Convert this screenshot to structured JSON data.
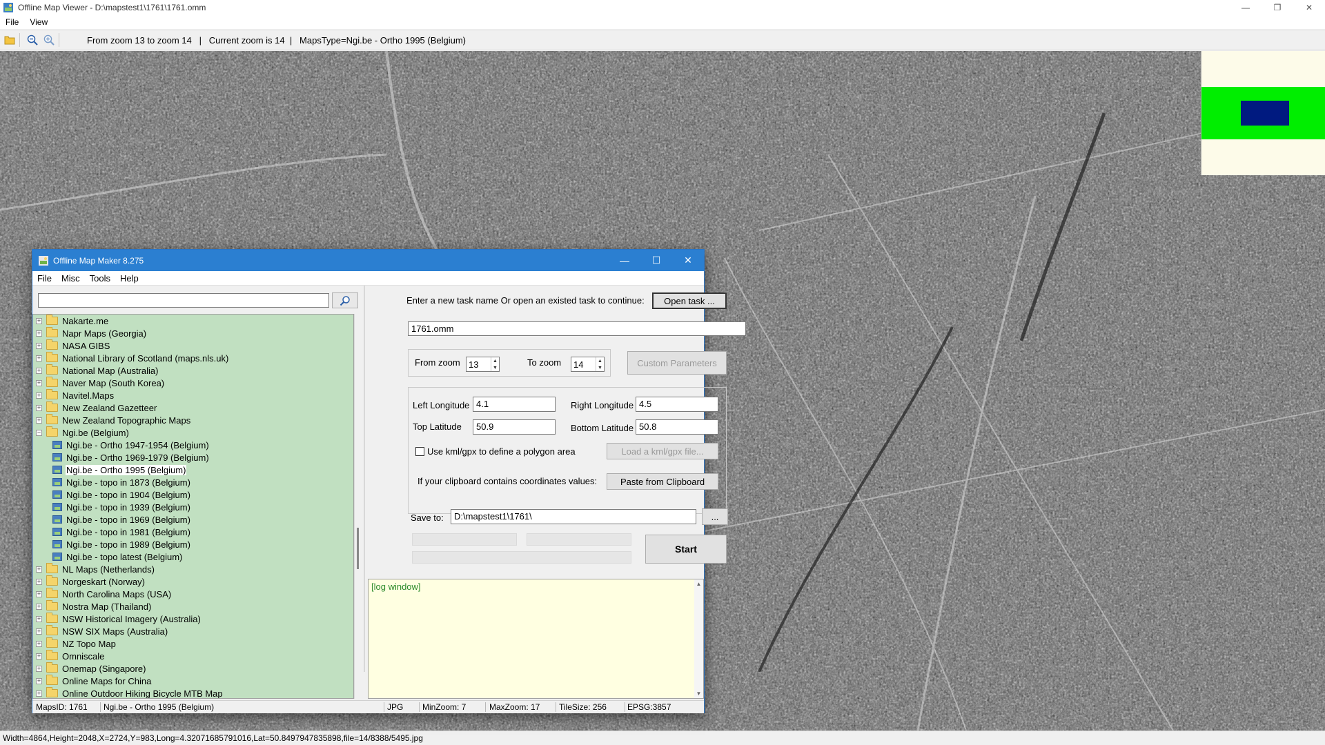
{
  "outer": {
    "title": "Offline Map Viewer - D:\\mapstest1\\1761\\1761.omm",
    "menu": [
      "File",
      "View"
    ],
    "zoom_status": "From zoom 13 to zoom 14   |   Current zoom is 14  |   MapsType=Ngi.be - Ortho 1995 (Belgium)",
    "bottom_status": "Width=4864,Height=2048,X=2724,Y=983,Long=4.32071685791016,Lat=50.8497947835898,file=14/8388/5495.jpg"
  },
  "dialog": {
    "title": "Offline Map Maker 8.275",
    "menu": [
      "File",
      "Misc",
      "Tools",
      "Help"
    ],
    "search": {
      "value": "",
      "placeholder": ""
    },
    "tree": [
      {
        "label": "Nakarte.me",
        "type": "folder",
        "expander": "+"
      },
      {
        "label": "Napr Maps (Georgia)",
        "type": "folder",
        "expander": "+"
      },
      {
        "label": "NASA GIBS",
        "type": "folder",
        "expander": "+"
      },
      {
        "label": "National Library of Scotland (maps.nls.uk)",
        "type": "folder",
        "expander": "+"
      },
      {
        "label": "National Map (Australia)",
        "type": "folder",
        "expander": "+"
      },
      {
        "label": "Naver Map (South Korea)",
        "type": "folder",
        "expander": "+"
      },
      {
        "label": "Navitel.Maps",
        "type": "folder",
        "expander": "+"
      },
      {
        "label": "New Zealand Gazetteer",
        "type": "folder",
        "expander": "+"
      },
      {
        "label": "New Zealand Topographic Maps",
        "type": "folder",
        "expander": "+"
      },
      {
        "label": "Ngi.be (Belgium)",
        "type": "folder",
        "expander": "−"
      },
      {
        "label": "Ngi.be - Ortho 1947-1954 (Belgium)",
        "type": "map"
      },
      {
        "label": "Ngi.be - Ortho 1969-1979 (Belgium)",
        "type": "map"
      },
      {
        "label": "Ngi.be - Ortho 1995 (Belgium)",
        "type": "map",
        "selected": true
      },
      {
        "label": "Ngi.be - topo in 1873 (Belgium)",
        "type": "map"
      },
      {
        "label": "Ngi.be - topo in 1904 (Belgium)",
        "type": "map"
      },
      {
        "label": "Ngi.be - topo in 1939 (Belgium)",
        "type": "map"
      },
      {
        "label": "Ngi.be - topo in 1969 (Belgium)",
        "type": "map"
      },
      {
        "label": "Ngi.be - topo in 1981 (Belgium)",
        "type": "map"
      },
      {
        "label": "Ngi.be - topo in 1989 (Belgium)",
        "type": "map"
      },
      {
        "label": "Ngi.be - topo latest (Belgium)",
        "type": "map"
      },
      {
        "label": "NL Maps (Netherlands)",
        "type": "folder",
        "expander": "+"
      },
      {
        "label": "Norgeskart (Norway)",
        "type": "folder",
        "expander": "+"
      },
      {
        "label": "North Carolina Maps (USA)",
        "type": "folder",
        "expander": "+"
      },
      {
        "label": "Nostra Map (Thailand)",
        "type": "folder",
        "expander": "+"
      },
      {
        "label": "NSW Historical Imagery (Australia)",
        "type": "folder",
        "expander": "+"
      },
      {
        "label": "NSW SIX Maps (Australia)",
        "type": "folder",
        "expander": "+"
      },
      {
        "label": "NZ Topo Map",
        "type": "folder",
        "expander": "+"
      },
      {
        "label": "Omniscale",
        "type": "folder",
        "expander": "+"
      },
      {
        "label": "Onemap (Singapore)",
        "type": "folder",
        "expander": "+"
      },
      {
        "label": "Online Maps for China",
        "type": "folder",
        "expander": "+"
      },
      {
        "label": "Online Outdoor Hiking Bicycle MTB Map",
        "type": "folder",
        "expander": "+"
      }
    ],
    "task": {
      "prompt": "Enter a new task name Or open an existed task to continue:",
      "open_button": "Open task ...",
      "name_value": "1761.omm"
    },
    "zoom": {
      "from_label": "From zoom",
      "from_value": "13",
      "to_label": "To zoom",
      "to_value": "14",
      "custom_button": "Custom Parameters"
    },
    "coords": {
      "left_lon_label": "Left Longitude",
      "left_lon": "4.1",
      "right_lon_label": "Right Longitude",
      "right_lon": "4.5",
      "top_lat_label": "Top Latitude",
      "top_lat": "50.9",
      "bottom_lat_label": "Bottom Latitude",
      "bottom_lat": "50.8",
      "kml_label": "Use kml/gpx to define a polygon area",
      "kml_button": "Load a kml/gpx file...",
      "clipboard_label": "If your clipboard contains coordinates values:",
      "clipboard_button": "Paste from Clipboard"
    },
    "save": {
      "label": "Save to:",
      "path": "D:\\mapstest1\\1761\\",
      "browse": "..."
    },
    "start_button": "Start",
    "log": "[log window]",
    "status": {
      "maps_id": "MapsID: 1761",
      "map_name": "Ngi.be - Ortho 1995 (Belgium)",
      "format": "JPG",
      "min_zoom": "MinZoom: 7",
      "max_zoom": "MaxZoom: 17",
      "tile_size": "TileSize: 256",
      "epsg": "EPSG:3857"
    }
  }
}
